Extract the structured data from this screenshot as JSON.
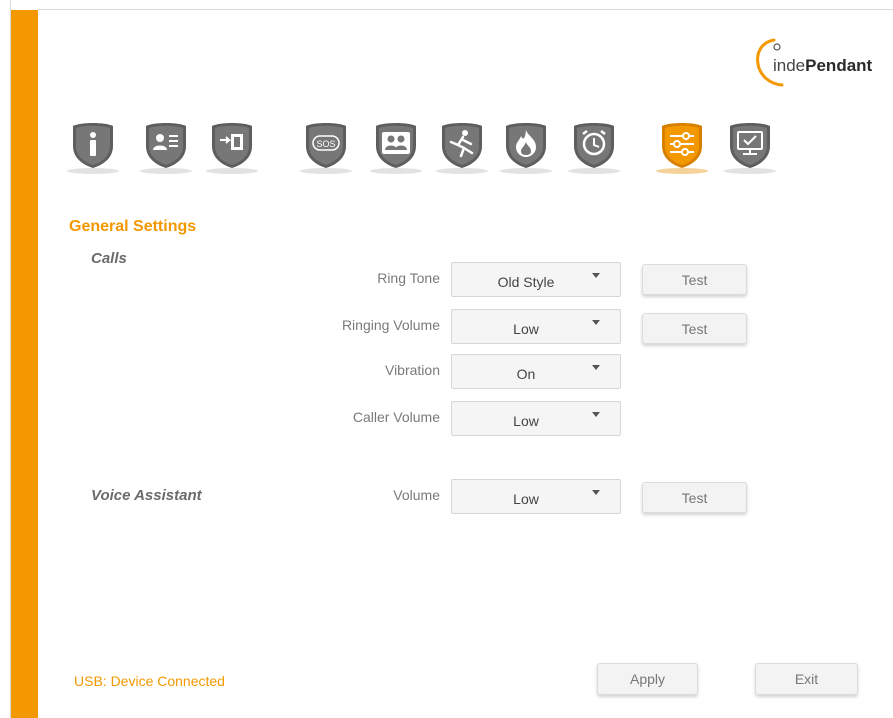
{
  "brand": {
    "logo_text_light": "inde",
    "logo_text_bold": "Pendant",
    "accent_color": "#f39800"
  },
  "nav": {
    "items": [
      {
        "name": "info",
        "icon": "info-icon",
        "glyph": "i",
        "active": false
      },
      {
        "name": "contact-card",
        "icon": "contact-card-icon",
        "glyph": "",
        "active": false
      },
      {
        "name": "device-transfer",
        "icon": "device-transfer-icon",
        "glyph": "",
        "active": false
      },
      {
        "name": "sos",
        "icon": "sos-icon",
        "glyph": "SOS",
        "active": false
      },
      {
        "name": "contacts",
        "icon": "contacts-icon",
        "glyph": "",
        "active": false
      },
      {
        "name": "fall-detection",
        "icon": "fall-detection-icon",
        "glyph": "",
        "active": false
      },
      {
        "name": "fire",
        "icon": "fire-icon",
        "glyph": "",
        "active": false
      },
      {
        "name": "alarm",
        "icon": "alarm-clock-icon",
        "glyph": "",
        "active": false
      },
      {
        "name": "general-settings",
        "icon": "sliders-icon",
        "glyph": "",
        "active": true
      },
      {
        "name": "monitor",
        "icon": "monitor-icon",
        "glyph": "",
        "active": false
      }
    ]
  },
  "page": {
    "title": "General Settings"
  },
  "calls": {
    "label": "Calls",
    "ring_tone": {
      "label": "Ring Tone",
      "value": "Old Style",
      "test": "Test"
    },
    "ringing_volume": {
      "label": "Ringing Volume",
      "value": "Low",
      "test": "Test"
    },
    "vibration": {
      "label": "Vibration",
      "value": "On"
    },
    "caller_volume": {
      "label": "Caller Volume",
      "value": "Low"
    }
  },
  "voice_assistant": {
    "label": "Voice Assistant",
    "volume": {
      "label": "Volume",
      "value": "Low",
      "test": "Test"
    }
  },
  "footer": {
    "status": "USB: Device Connected",
    "apply": "Apply",
    "exit": "Exit"
  }
}
